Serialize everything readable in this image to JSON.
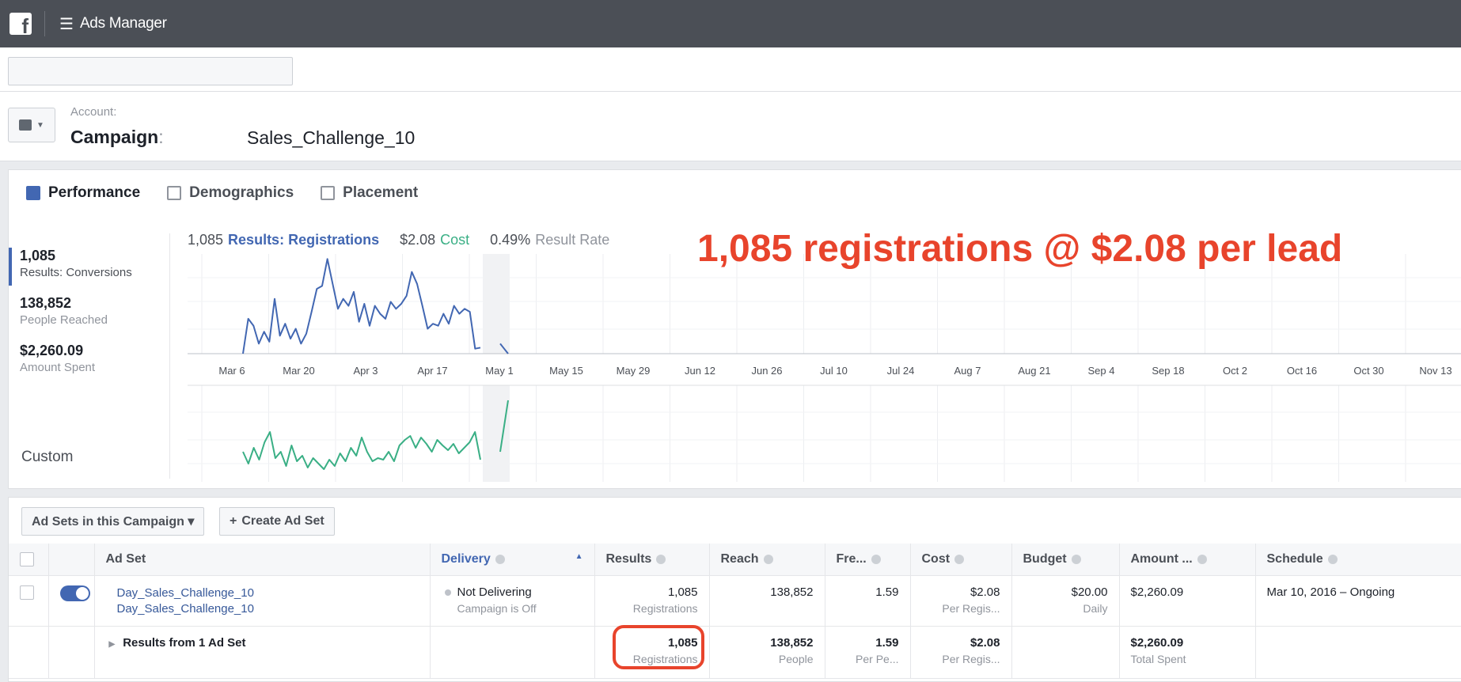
{
  "topbar": {
    "logo_glyph": "f",
    "menu_glyph": "☰",
    "title": "Ads Manager"
  },
  "header": {
    "account_label": "Account:",
    "campaign_label": "Campaign",
    "campaign_colon": ":",
    "campaign_name": "Sales_Challenge_10"
  },
  "tabs": [
    {
      "label": "Performance",
      "icon": "bar-chart-icon"
    },
    {
      "label": "Demographics",
      "icon": "people-icon"
    },
    {
      "label": "Placement",
      "icon": "placement-icon"
    }
  ],
  "metrics": [
    {
      "value": "1,085",
      "label": "Results: Conversions"
    },
    {
      "value": "138,852",
      "label": "People Reached"
    },
    {
      "value": "$2,260.09",
      "label": "Amount Spent"
    }
  ],
  "custom_label": "Custom",
  "summary": {
    "results_num": "1,085",
    "results_label": "Results: Registrations",
    "cost_num": "$2.08",
    "cost_label": "Cost",
    "rate_num": "0.49%",
    "rate_label": "Result Rate"
  },
  "annotation": "1,085 registrations @ $2.08 per lead",
  "chart_data": {
    "type": "line",
    "x_tick_labels": [
      "Mar 6",
      "Mar 20",
      "Apr 3",
      "Apr 17",
      "May 1",
      "May 15",
      "May 29",
      "Jun 12",
      "Jun 26",
      "Jul 10",
      "Jul 24",
      "Aug 7",
      "Aug 21",
      "Sep 4",
      "Sep 18",
      "Oct 2",
      "Oct 16",
      "Oct 30",
      "Nov 13"
    ],
    "grid": true,
    "series": [
      {
        "color": "#4267b2",
        "values": [
          0.0,
          0.35,
          0.28,
          0.1,
          0.22,
          0.12,
          0.55,
          0.18,
          0.3,
          0.15,
          0.25,
          0.1,
          0.2,
          0.42,
          0.65,
          0.68,
          0.95,
          0.7,
          0.45,
          0.55,
          0.48,
          0.62,
          0.32,
          0.5,
          0.28,
          0.48,
          0.4,
          0.35,
          0.52,
          0.45,
          0.5,
          0.58,
          0.82,
          0.7,
          0.48,
          0.25,
          0.3,
          0.28,
          0.4,
          0.3,
          0.48,
          0.4,
          0.45,
          0.42,
          0.05,
          0.06
        ],
        "late_segment": [
          0.1,
          0.0
        ]
      },
      {
        "color": "#3aaf85",
        "values": [
          0.3,
          0.15,
          0.35,
          0.2,
          0.42,
          0.55,
          0.22,
          0.3,
          0.12,
          0.38,
          0.18,
          0.25,
          0.1,
          0.22,
          0.15,
          0.08,
          0.2,
          0.12,
          0.28,
          0.18,
          0.35,
          0.25,
          0.48,
          0.3,
          0.18,
          0.22,
          0.2,
          0.3,
          0.18,
          0.38,
          0.45,
          0.5,
          0.35,
          0.48,
          0.4,
          0.3,
          0.45,
          0.38,
          0.32,
          0.4,
          0.28,
          0.35,
          0.42,
          0.55,
          0.2
        ],
        "late_segment": [
          0.3,
          0.95
        ]
      }
    ]
  },
  "table": {
    "buttons": {
      "adsets_label": "Ad Sets in this Campaign ▾",
      "create_label": "Create Ad Set"
    },
    "headers": [
      "Ad Set",
      "Delivery",
      "Results",
      "Reach",
      "Fre...",
      "Cost",
      "Budget",
      "Amount ...",
      "Schedule"
    ],
    "row": {
      "name_line1": "Day_Sales_Challenge_10",
      "name_line2": "Day_Sales_Challenge_10",
      "delivery": "Not Delivering",
      "delivery_sub": "Campaign is Off",
      "results": "1,085",
      "results_sub": "Registrations",
      "reach": "138,852",
      "frequency": "1.59",
      "cost": "$2.08",
      "cost_sub": "Per Regis...",
      "budget": "$20.00",
      "budget_sub": "Daily",
      "amount": "$2,260.09",
      "schedule": "Mar 10, 2016 – Ongoing"
    },
    "total": {
      "label": "Results from 1 Ad Set",
      "results": "1,085",
      "results_sub": "Registrations",
      "reach": "138,852",
      "reach_sub": "People",
      "frequency": "1.59",
      "frequency_sub": "Per Pe...",
      "cost": "$2.08",
      "cost_sub": "Per Regis...",
      "amount": "$2,260.09",
      "amount_sub": "Total Spent"
    }
  },
  "colors": {
    "topbar": "#4b4f56",
    "accent": "#4267b2",
    "cost_green": "#3aaf85",
    "annotation_red": "#e8442c"
  }
}
